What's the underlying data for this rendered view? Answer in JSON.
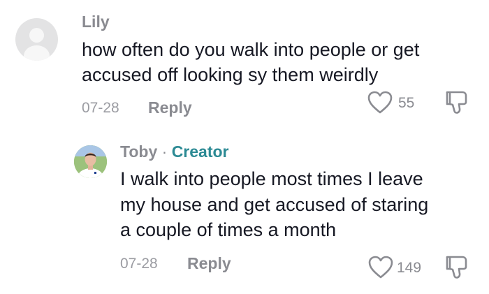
{
  "comment": {
    "username": "Lily",
    "text_line1": "how often do you walk into people or get",
    "text_line2": "accused off looking sy them weirdly",
    "date": "07-28",
    "reply_label": "Reply",
    "like_count": "55",
    "avatar_icon": "default-user-avatar-icon",
    "like_icon": "heart-outline-icon",
    "dislike_icon": "thumbs-down-icon"
  },
  "reply": {
    "username": "Toby",
    "separator": "·",
    "badge": "Creator",
    "text_line1": "I walk into people most times I leave",
    "text_line2": "my house and get accused of staring",
    "text_line3": "a couple of times a month",
    "date": "07-28",
    "reply_label": "Reply",
    "like_count": "149",
    "avatar_icon": "user-photo-avatar",
    "like_icon": "heart-outline-icon",
    "dislike_icon": "thumbs-down-icon"
  },
  "colors": {
    "text_primary": "#161823",
    "text_secondary": "#8a8b91",
    "creator_badge": "#2c8a94",
    "avatar_placeholder": "#e3e3e4"
  }
}
